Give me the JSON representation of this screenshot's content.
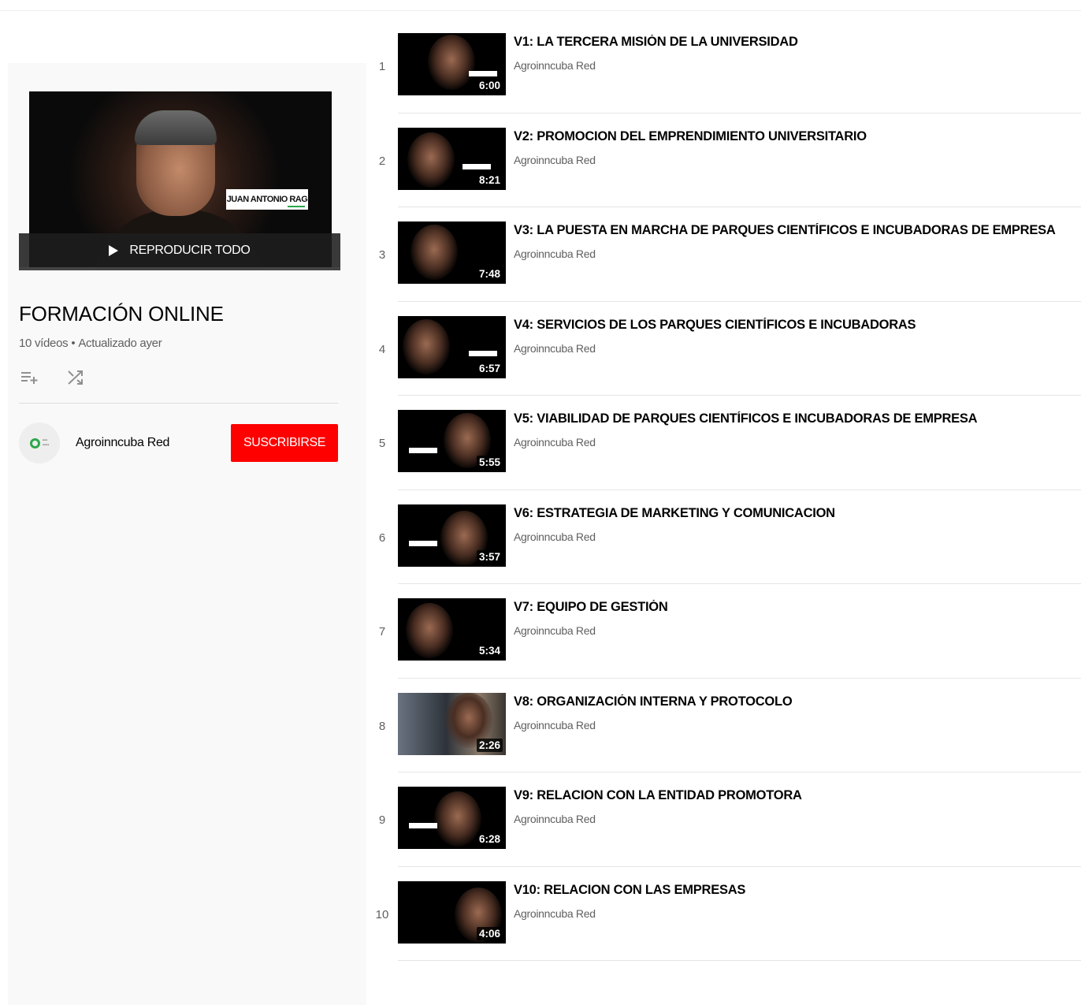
{
  "playlist": {
    "play_all_label": "REPRODUCIR TODO",
    "hero_name_tag": "JUAN ANTONIO RAG",
    "title": "FORMACIÓN ONLINE",
    "video_count": "10 vídeos",
    "separator": "•",
    "updated": "Actualizado ayer",
    "actions": [
      {
        "icon": "add-to-queue-icon"
      },
      {
        "icon": "shuffle-icon"
      }
    ],
    "owner": {
      "name": "Agroinncuba Red",
      "subscribe_label": "SUSCRIBIRSE"
    }
  },
  "colors": {
    "subscribe_bg": "#ff0000",
    "sidebar_bg": "#f9f9f9",
    "text_secondary": "#606060",
    "logo_green": "#2ea84c"
  },
  "videos": [
    {
      "index": "1",
      "title": "V1: LA TERCERA MISIÓN DE LA UNIVERSIDAD",
      "channel": "Agroinncuba Red",
      "duration": "6:00"
    },
    {
      "index": "2",
      "title": "V2: PROMOCION DEL EMPRENDIMIENTO UNIVERSITARIO",
      "channel": "Agroinncuba Red",
      "duration": "8:21"
    },
    {
      "index": "3",
      "title": "V3: LA PUESTA EN MARCHA DE PARQUES CIENTÍFICOS E INCUBADORAS DE EMPRESA",
      "channel": "Agroinncuba Red",
      "duration": "7:48"
    },
    {
      "index": "4",
      "title": "V4: SERVICIOS DE LOS PARQUES CIENTÍFICOS E INCUBADORAS",
      "channel": "Agroinncuba Red",
      "duration": "6:57"
    },
    {
      "index": "5",
      "title": "V5: VIABILIDAD DE PARQUES CIENTÍFICOS E INCUBADORAS DE EMPRESA",
      "channel": "Agroinncuba Red",
      "duration": "5:55"
    },
    {
      "index": "6",
      "title": "V6: ESTRATEGIA DE MARKETING Y COMUNICACION",
      "channel": "Agroinncuba Red",
      "duration": "3:57"
    },
    {
      "index": "7",
      "title": "V7: EQUIPO DE GESTIÓN",
      "channel": "Agroinncuba Red",
      "duration": "5:34"
    },
    {
      "index": "8",
      "title": "V8: ORGANIZACIÓN INTERNA Y PROTOCOLO",
      "channel": "Agroinncuba Red",
      "duration": "2:26"
    },
    {
      "index": "9",
      "title": "V9: RELACION CON LA ENTIDAD PROMOTORA",
      "channel": "Agroinncuba Red",
      "duration": "6:28"
    },
    {
      "index": "10",
      "title": "V10: RELACION CON LAS EMPRESAS",
      "channel": "Agroinncuba Red",
      "duration": "4:06"
    }
  ]
}
